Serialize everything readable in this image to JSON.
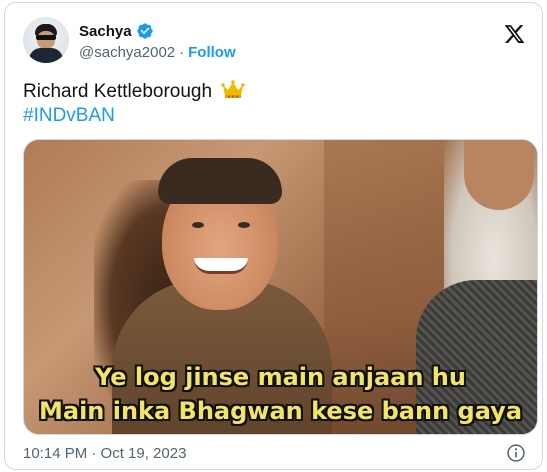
{
  "tweet": {
    "author": {
      "display_name": "Sachya",
      "handle": "@sachya2002",
      "separator": "·",
      "follow_label": "Follow",
      "verified": true,
      "avatar_icon": "avatar-person-sunglasses"
    },
    "text_line1": "Richard Kettleborough",
    "text_emoji": "crown-emoji",
    "hashtag": "#INDvBAN",
    "media": {
      "caption_line1": "Ye log jinse main anjaan hu",
      "caption_line2": "Main inka Bhagwan kese bann gaya"
    },
    "timestamp": "10:14 PM · Oct 19, 2023"
  },
  "colors": {
    "accent": "#1d9bf0",
    "text": "#0f1419",
    "muted": "#536471",
    "border": "#cfd9de",
    "caption": "#f2e36b"
  },
  "icons": {
    "brand": "x-logo-icon",
    "verified": "verified-badge-icon",
    "info": "info-icon"
  }
}
